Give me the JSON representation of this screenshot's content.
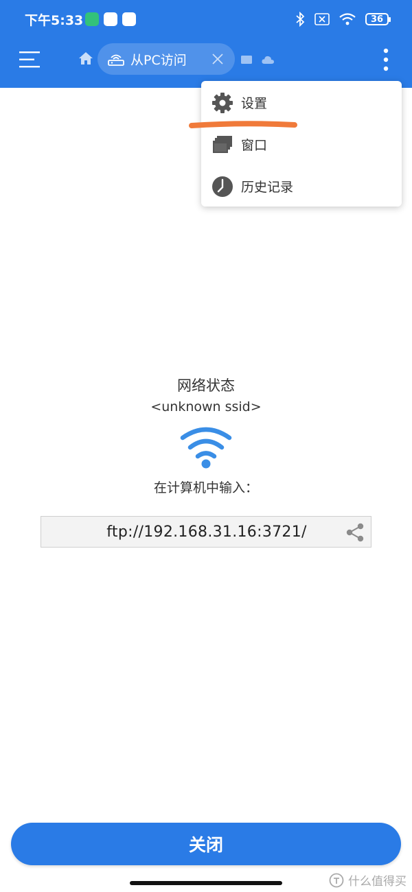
{
  "status_bar": {
    "time": "下午5:33",
    "battery": "36"
  },
  "toolbar": {
    "tab_label": "从PC访问"
  },
  "popup_menu": {
    "items": [
      {
        "label": "设置",
        "icon": "gear-icon"
      },
      {
        "label": "窗口",
        "icon": "windows-stack-icon"
      },
      {
        "label": "历史记录",
        "icon": "clock-icon"
      }
    ]
  },
  "main": {
    "network_title": "网络状态",
    "ssid": "<unknown ssid>",
    "instruction": "在计算机中输入：",
    "url": "ftp://192.168.31.16:3721/"
  },
  "footer": {
    "close_label": "关闭",
    "watermark": "什么值得买"
  },
  "colors": {
    "primary": "#2a7be6",
    "highlight_stroke": "#f07a3a",
    "wifi": "#3a8ee6"
  }
}
